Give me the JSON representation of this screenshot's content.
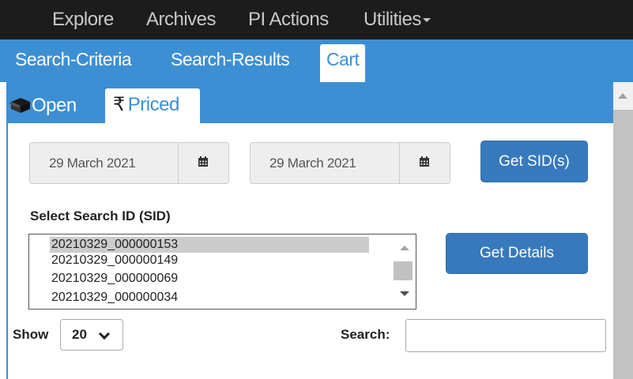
{
  "nav": {
    "items": [
      "Explore",
      "Archives",
      "PI Actions",
      "Utilities"
    ]
  },
  "main_tabs": [
    "Search-Criteria",
    "Search-Results",
    "Cart"
  ],
  "sub_tabs": {
    "open": "Open",
    "priced": "Priced",
    "priced_symbol": "₹"
  },
  "dates": {
    "from": "29 March 2021",
    "to": "29 March 2021"
  },
  "buttons": {
    "get_sids": "Get SID(s)",
    "get_details": "Get Details"
  },
  "sid": {
    "label": "Select Search ID (SID)",
    "options": [
      "20210329_000000153",
      "20210329_000000149",
      "20210329_000000069",
      "20210329_000000034"
    ],
    "selected_index": 0
  },
  "table_controls": {
    "show_label": "Show",
    "show_value": "20",
    "search_label": "Search:",
    "search_value": ""
  },
  "colors": {
    "accent": "#3d8fd4",
    "button": "#3779bd",
    "navbar": "#1c1c1c"
  },
  "icons": [
    "box-icon",
    "rupee-icon",
    "calendar-icon",
    "chevron-down-icon"
  ]
}
